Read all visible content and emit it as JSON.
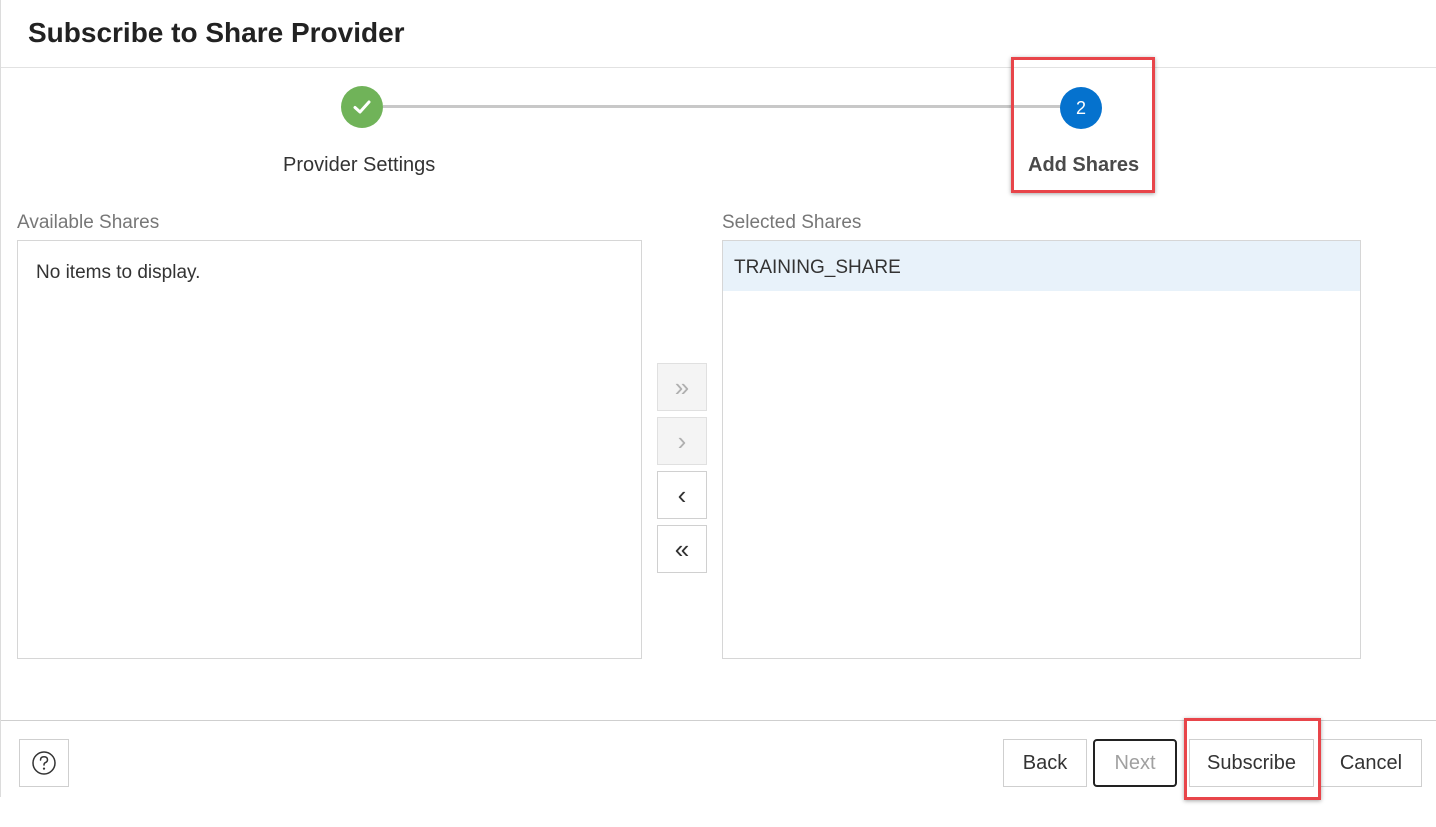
{
  "dialog": {
    "title": "Subscribe to Share Provider"
  },
  "train": {
    "steps": [
      {
        "label": "Provider Settings",
        "state": "completed",
        "icon": "check-icon"
      },
      {
        "label": "Add Shares",
        "number": "2",
        "state": "current"
      }
    ]
  },
  "shuttle": {
    "available_label": "Available Shares",
    "available_empty_text": "No items to display.",
    "selected_label": "Selected Shares",
    "selected_items": [
      "TRAINING_SHARE"
    ],
    "buttons": [
      {
        "icon": "move-all-right-icon",
        "glyph": "»",
        "enabled": false
      },
      {
        "icon": "move-right-icon",
        "glyph": "›",
        "enabled": false
      },
      {
        "icon": "move-left-icon",
        "glyph": "‹",
        "enabled": true
      },
      {
        "icon": "move-all-left-icon",
        "glyph": "«",
        "enabled": true
      }
    ]
  },
  "footer": {
    "help_icon": "help-icon",
    "back_label": "Back",
    "next_label": "Next",
    "subscribe_label": "Subscribe",
    "cancel_label": "Cancel"
  },
  "colors": {
    "step_completed": "#70b359",
    "step_current": "#0572ce",
    "highlight": "#e8454a",
    "selected_row": "#e8f2fa"
  }
}
